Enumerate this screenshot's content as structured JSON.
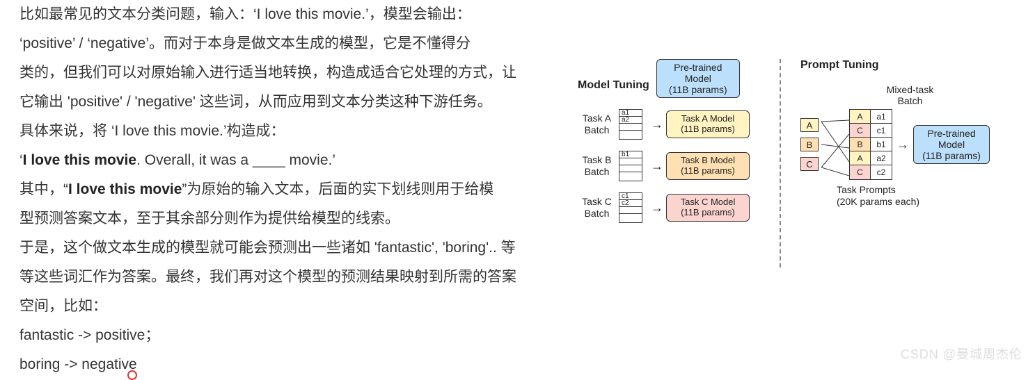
{
  "text": {
    "p1": "比如最常见的文本分类问题，输入：‘I love this movie.’，模型会输出：",
    "p2": "‘positive’ / ‘negative’。而对于本身是做文本生成的模型，它是不懂得分",
    "p3": "类的，但我们可以对原始输入进行适当地转换，构造成适合它处理的方式，让",
    "p4_a": "它输出 'positive' / 'negative' 这些词，从而应用到文本分类这种下游任务。",
    "p5_a": "具体来说，将 ‘I love this movie.’构造成：",
    "p6_a": "‘",
    "p6_b": "I love this movie",
    "p6_c": ". Overall, it was a ____ movie.’",
    "p7_a": "其中，“",
    "p7_b": "I love this movie",
    "p7_c": "”为原始的输入文本，后面的实下划线则用于给模",
    "p8": "型预测答案文本，至于其余部分则作为提供给模型的线索。",
    "p9": "于是，这个做文本生成的模型就可能会预测出一些诸如 'fantastic', 'boring'.. 等",
    "p10": "等这些词汇作为答案。最终，我们再对这个模型的预测结果映射到所需的答案",
    "p11": "空间，比如：",
    "p12": "fantastic -> positive；",
    "p13": "boring -> negative"
  },
  "diagram": {
    "left_title": "Model Tuning",
    "right_title": "Prompt Tuning",
    "pretrained": {
      "l1": "Pre-trained",
      "l2": "Model",
      "l3": "(11B params)"
    },
    "tasks": [
      {
        "label_l1": "Task A",
        "label_l2": "Batch",
        "cells": [
          "a1",
          "a2",
          "",
          ""
        ],
        "model_l1": "Task A Model",
        "model_l2": "(11B params)",
        "color": "yellow"
      },
      {
        "label_l1": "Task B",
        "label_l2": "Batch",
        "cells": [
          "b1",
          "",
          "",
          ""
        ],
        "model_l1": "Task B Model",
        "model_l2": "(11B params)",
        "color": "orange"
      },
      {
        "label_l1": "Task C",
        "label_l2": "Batch",
        "cells": [
          "c1",
          "c2",
          "",
          ""
        ],
        "model_l1": "Task C Model",
        "model_l2": "(11B params)",
        "color": "pink"
      }
    ],
    "mixed_title": "Mixed-task\nBatch",
    "mix_labels": [
      "A",
      "B",
      "C"
    ],
    "mix_rows": [
      {
        "p": "A",
        "d": "a1",
        "cls": "lbl-a"
      },
      {
        "p": "C",
        "d": "c1",
        "cls": "lbl-c"
      },
      {
        "p": "B",
        "d": "b1",
        "cls": "lbl-b"
      },
      {
        "p": "A",
        "d": "a2",
        "cls": "lbl-a"
      },
      {
        "p": "C",
        "d": "c2",
        "cls": "lbl-c"
      }
    ],
    "pt_model": {
      "l1": "Pre-trained",
      "l2": "Model",
      "l3": "(11B params)"
    },
    "tp_caption_l1": "Task Prompts",
    "tp_caption_l2": "(20K params each)"
  },
  "arrow": "→",
  "watermark": "CSDN @曼城周杰伦"
}
